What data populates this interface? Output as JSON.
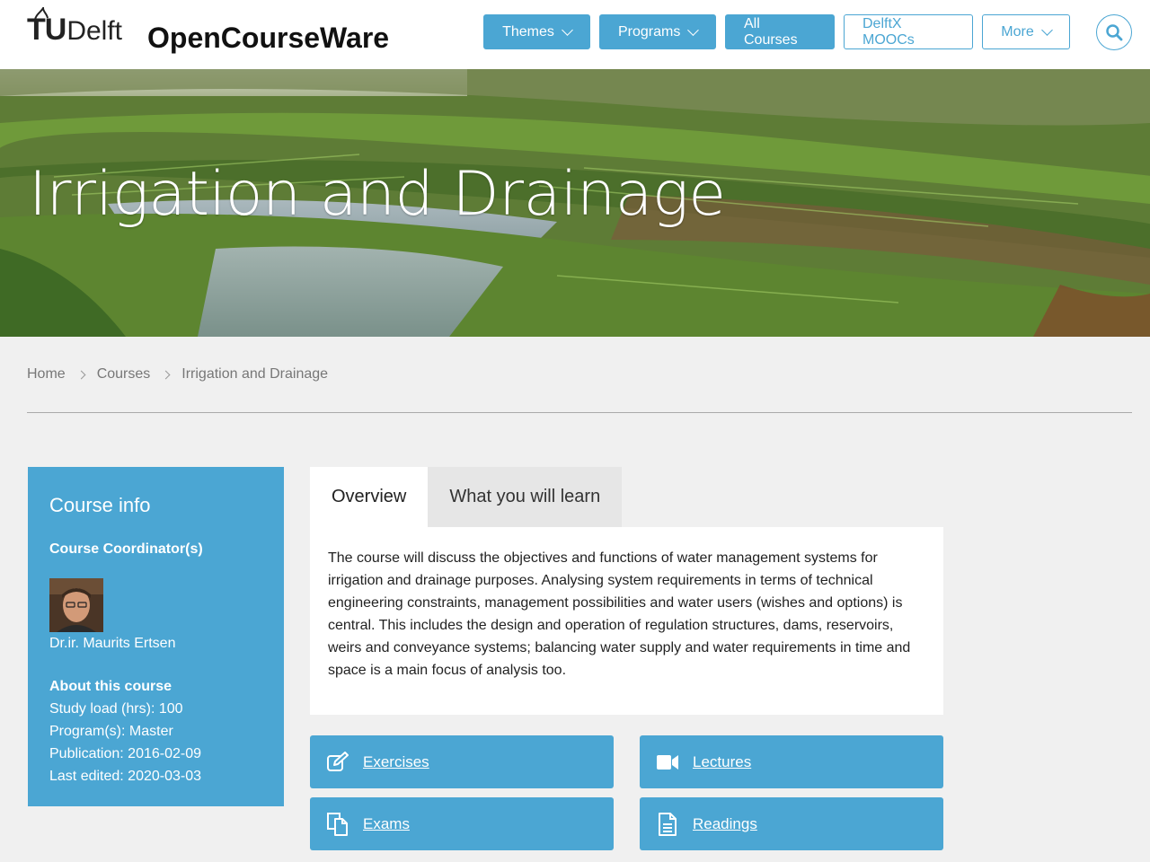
{
  "header": {
    "logo_tu": "TU",
    "logo_delft": "Delft",
    "site_title": "OpenCourseWare",
    "nav": [
      {
        "label": "Themes",
        "has_dropdown": true,
        "style": "filled"
      },
      {
        "label": "Programs",
        "has_dropdown": true,
        "style": "filled"
      },
      {
        "label": "All Courses",
        "has_dropdown": false,
        "style": "filled"
      },
      {
        "label": "DelftX MOOCs",
        "has_dropdown": false,
        "style": "outline"
      },
      {
        "label": "More",
        "has_dropdown": true,
        "style": "outline"
      }
    ],
    "search_icon": "search-icon"
  },
  "hero": {
    "title": "Irrigation and Drainage"
  },
  "breadcrumb": [
    "Home",
    "Courses",
    "Irrigation and Drainage"
  ],
  "course_info": {
    "title": "Course info",
    "coordinator_label": "Course Coordinator(s)",
    "coordinator_name": "Dr.ir. Maurits Ertsen",
    "about_label": "About this course",
    "study_load": "Study load (hrs): 100",
    "programs": "Program(s): Master",
    "publication": "Publication: 2016-02-09",
    "last_edited": "Last edited: 2020-03-03"
  },
  "tabs": [
    {
      "label": "Overview",
      "active": true
    },
    {
      "label": "What you will learn",
      "active": false
    }
  ],
  "overview_text": "The course will discuss the objectives and functions of water management systems for irrigation and drainage purposes. Analysing system requirements in terms of technical engineering constraints, management possibilities and water users (wishes and options) is central. This includes the design and operation of regulation structures, dams, reservoirs, weirs and conveyance systems; balancing water supply and water requirements in time and space is a main focus of analysis too.",
  "resources": [
    {
      "label": "Exercises",
      "icon": "edit-icon"
    },
    {
      "label": "Lectures",
      "icon": "video-camera-icon"
    },
    {
      "label": "Exams",
      "icon": "documents-icon"
    },
    {
      "label": "Readings",
      "icon": "document-text-icon"
    }
  ],
  "colors": {
    "accent": "#4ba6d3",
    "page_bg": "#f0f0f0"
  }
}
